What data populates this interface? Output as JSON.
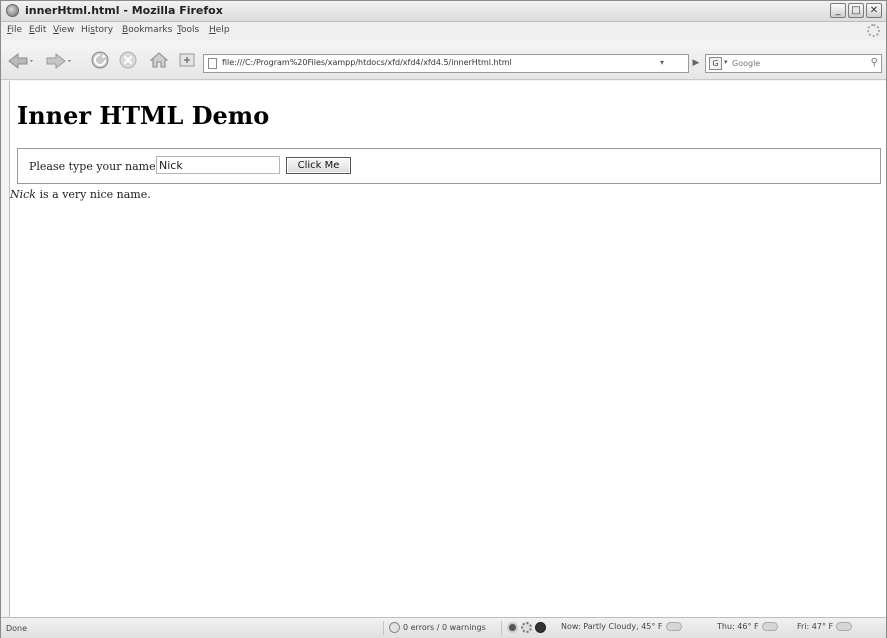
{
  "window": {
    "title": "innerHtml.html - Mozilla Firefox",
    "controls": {
      "minimize": "_",
      "maximize": "□",
      "close": "✕"
    }
  },
  "menu": {
    "items": [
      {
        "pre": "",
        "accel": "F",
        "post": "ile"
      },
      {
        "pre": "",
        "accel": "E",
        "post": "dit"
      },
      {
        "pre": "",
        "accel": "V",
        "post": "iew"
      },
      {
        "pre": "Hi",
        "accel": "s",
        "post": "tory"
      },
      {
        "pre": "",
        "accel": "B",
        "post": "ookmarks"
      },
      {
        "pre": "",
        "accel": "T",
        "post": "ools"
      },
      {
        "pre": "",
        "accel": "H",
        "post": "elp"
      }
    ]
  },
  "toolbar": {
    "icons": [
      "back-icon",
      "forward-icon",
      "reload-icon",
      "stop-icon",
      "home-icon",
      "new-tab-icon"
    ],
    "url": "file:///C:/Program%20Files/xampp/htdocs/xfd/xfd4/xfd4.5/innerHtml.html",
    "search_placeholder": "Google",
    "search_engine_icon": "G"
  },
  "page": {
    "heading": "Inner HTML Demo",
    "prompt_label": "Please type your name",
    "name_value": "Nick",
    "button_label": "Click Me",
    "output_name": "Nick",
    "output_suffix": " is a very nice name."
  },
  "status": {
    "text": "Done",
    "errors": "0 errors / 0 warnings",
    "weather_now": "Now: Partly Cloudy, 45° F",
    "weather_thu": "Thu: 46° F",
    "weather_fri": "Fri: 47° F"
  }
}
